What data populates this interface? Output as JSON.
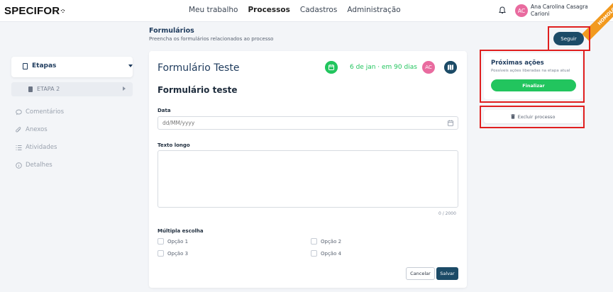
{
  "app": {
    "logo_text": "SPECIFOR",
    "logo_mark": "·:·",
    "environment_badge": "HOMOLOG"
  },
  "nav": {
    "items": [
      "Meu trabalho",
      "Processos",
      "Cadastros",
      "Administração"
    ],
    "active": "Processos"
  },
  "user": {
    "initials": "AC",
    "name_line1": "Ana Carolina Casagrande",
    "name_line2": "Carioni"
  },
  "header": {
    "title": "Formulários",
    "subtitle": "Preencha os formulários relacionados ao processo",
    "follow_label": "Seguir"
  },
  "sidebar": {
    "steps_label": "Etapas",
    "step_item": "ETAPA 2",
    "links": [
      {
        "label": "Comentários",
        "icon": "comment-icon"
      },
      {
        "label": "Anexos",
        "icon": "paperclip-icon"
      },
      {
        "label": "Atividades",
        "icon": "list-icon"
      },
      {
        "label": "Detalhes",
        "icon": "info-icon"
      }
    ]
  },
  "form": {
    "name": "Formulário Teste",
    "due_text": "6 de jan · em 90 dias",
    "assignee_initials": "AC",
    "heading": "Formulário teste",
    "date_label": "Data",
    "date_placeholder": "dd/MM/yyyy",
    "long_text_label": "Texto longo",
    "char_counter": "0 / 2000",
    "multiple_choice_label": "Múltipla escolha",
    "options": [
      "Opção 1",
      "Opção 2",
      "Opção 3",
      "Opção 4"
    ],
    "cancel_label": "Cancelar",
    "save_label": "Salvar"
  },
  "actions": {
    "title": "Próximas ações",
    "subtitle": "Possíveis ações liberadas na etapa atual",
    "finalize_label": "Finalizar",
    "delete_label": "Excluir processo"
  },
  "colors": {
    "primary": "#1c4b67",
    "success": "#22c55e",
    "avatar": "#e96b9f",
    "highlight": "#e01f1f",
    "ribbon": "#f29a1f"
  }
}
